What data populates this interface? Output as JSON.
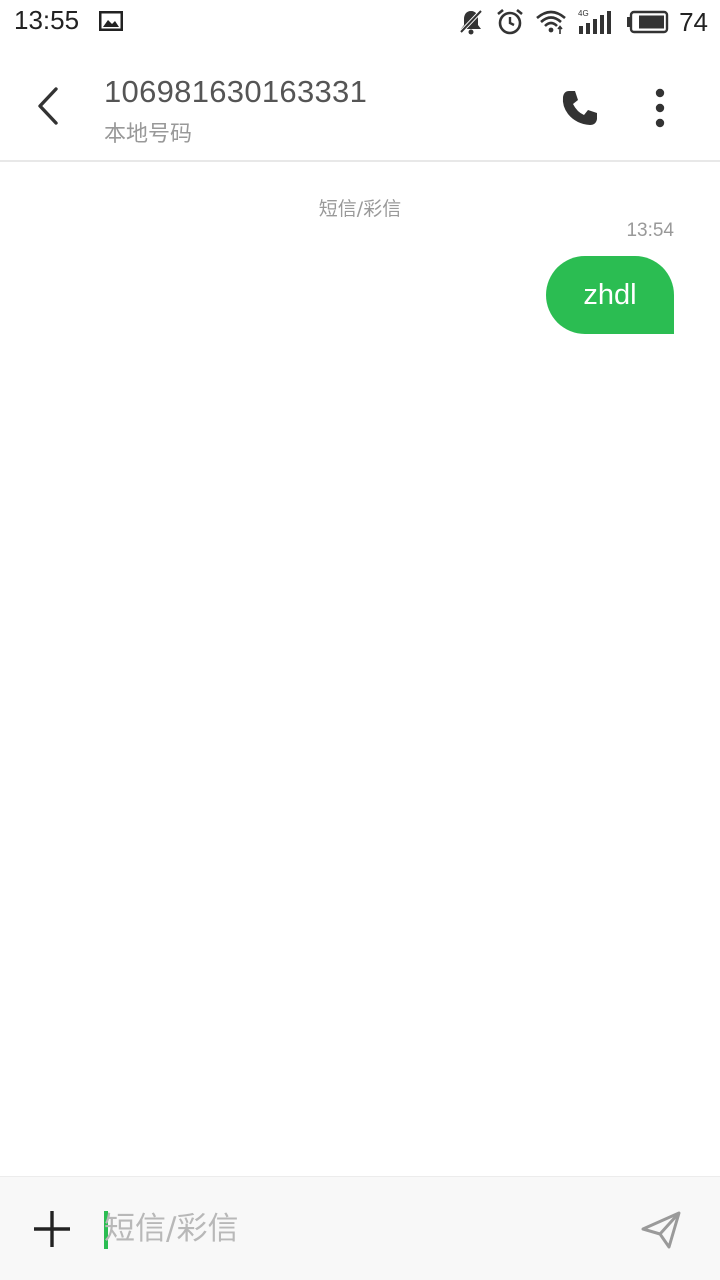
{
  "status_bar": {
    "time": "13:55",
    "battery_level": "74",
    "icons": [
      "image-icon",
      "notifications-off-icon",
      "alarm-icon",
      "wifi-icon",
      "signal-4g-icon",
      "battery-icon"
    ],
    "network_label": "4G"
  },
  "header": {
    "title": "106981630163331",
    "subtitle": "本地号码",
    "back_icon": "chevron-left-icon",
    "call_icon": "phone-icon",
    "more_icon": "more-vertical-icon"
  },
  "conversation": {
    "type_label": "短信/彩信",
    "messages": [
      {
        "time": "13:54",
        "text": "zhdl",
        "direction": "outgoing"
      }
    ]
  },
  "input_bar": {
    "placeholder": "短信/彩信",
    "value": "",
    "add_icon": "plus-icon",
    "send_icon": "send-icon"
  },
  "colors": {
    "accent": "#2bbd52",
    "bubble_text": "#ffffff",
    "muted_text": "#999999"
  }
}
